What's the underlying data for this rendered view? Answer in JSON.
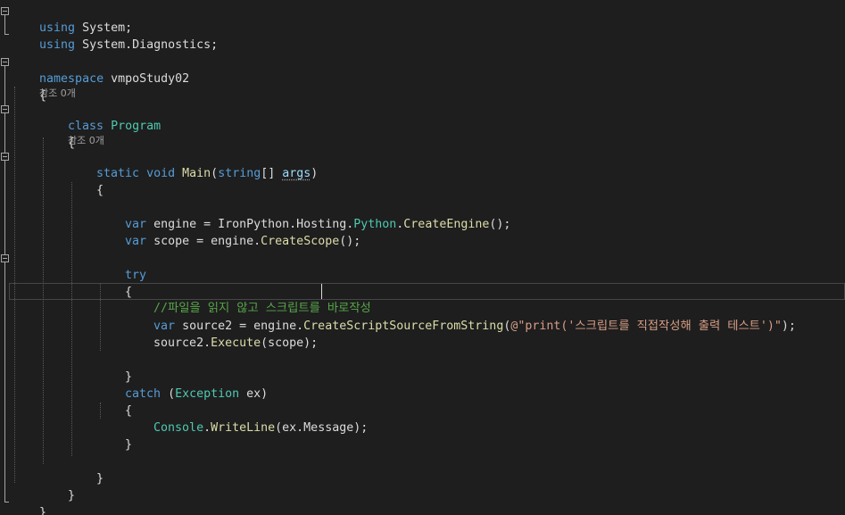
{
  "editor": {
    "language": "C#",
    "codelens_ref_label": "참조 0개",
    "lines": {
      "using_system": {
        "kw": "using",
        "rest": " System;"
      },
      "using_diag": {
        "kw": "using",
        "rest": " System.Diagnostics;"
      },
      "namespace_decl": {
        "kw": "namespace",
        "name": " vmpoStudy02"
      },
      "brace_open": "{",
      "brace_close": "}",
      "class_decl": {
        "kw": "class",
        "name": "Program"
      },
      "main_decl": {
        "kw_static": "static",
        "kw_void": "void",
        "method": "Main",
        "paren_open": "(",
        "kw_string": "string",
        "brackets": "[] ",
        "param": "args",
        "paren_close": ")"
      },
      "engine_line": {
        "kw": "var",
        "rest": " engine = IronPython.Hosting.",
        "type": "Python",
        "dot": ".",
        "method": "CreateEngine",
        "end": "();"
      },
      "scope_line": {
        "kw": "var",
        "rest": " scope = engine.",
        "method": "CreateScope",
        "end": "();"
      },
      "try_kw": "try",
      "comment_line": "//파일을 읽지 않고 스크립트를 바로작성",
      "source2_line": {
        "kw": "var",
        "rest": " source2 = engine.",
        "method": "CreateScriptSourceFromString",
        "paren": "(",
        "string": "@\"print('스크립트를 직접작성해 출력 테스트')\"",
        "end": ");"
      },
      "execute_line": {
        "obj": "source2.",
        "method": "Execute",
        "end": "(scope);"
      },
      "catch_line": {
        "kw": "catch",
        "paren": " (",
        "type": "Exception",
        "rest": " ex)"
      },
      "writeline_line": {
        "type": "Console",
        "dot": ".",
        "method": "WriteLine",
        "end": "(ex.Message);"
      }
    }
  },
  "colors": {
    "background": "#1e1e1e",
    "keyword": "#569cd6",
    "type": "#4ec9b0",
    "method": "#dcdcaa",
    "string": "#d69d85",
    "comment": "#57a64a",
    "plain": "#dcdcdc"
  }
}
